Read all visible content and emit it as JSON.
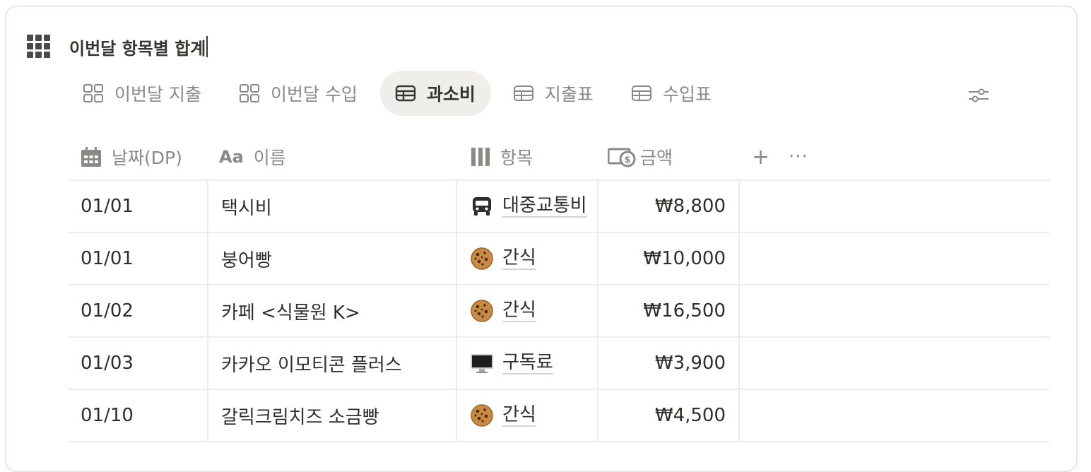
{
  "db": {
    "title": "이번달 항목별 합계"
  },
  "tabs": [
    {
      "label": "이번달 지출",
      "icon": "gallery-icon",
      "active": false
    },
    {
      "label": "이번달 수입",
      "icon": "gallery-icon",
      "active": false
    },
    {
      "label": "과소비",
      "icon": "table-icon",
      "active": true
    },
    {
      "label": "지출표",
      "icon": "table-icon",
      "active": false
    },
    {
      "label": "수입표",
      "icon": "table-icon",
      "active": false
    }
  ],
  "columns": {
    "date": {
      "label": "날짜(DP)",
      "icon": "calendar-icon"
    },
    "name": {
      "label": "이름",
      "icon": "text-aa-icon"
    },
    "category": {
      "label": "항목",
      "icon": "select-bars-icon"
    },
    "amount": {
      "label": "금액",
      "icon": "money-icon"
    },
    "add": "+",
    "more": "···"
  },
  "rows": [
    {
      "date": "01/01",
      "name": "택시비",
      "category": "대중교통비",
      "category_icon": "bus-icon",
      "amount": "₩8,800"
    },
    {
      "date": "01/01",
      "name": "붕어빵",
      "category": "간식",
      "category_icon": "cookie-icon",
      "amount": "₩10,000"
    },
    {
      "date": "01/02",
      "name": "카페 <식물원 K>",
      "category": "간식",
      "category_icon": "cookie-icon",
      "amount": "₩16,500"
    },
    {
      "date": "01/03",
      "name": "카카오 이모티콘 플러스",
      "category": "구독료",
      "category_icon": "computer-icon",
      "amount": "₩3,900"
    },
    {
      "date": "01/10",
      "name": "갈릭크림치즈 소금빵",
      "category": "간식",
      "category_icon": "cookie-icon",
      "amount": "₩4,500"
    }
  ],
  "colors": {
    "active_tab_bg": "#efeeeb",
    "muted_text": "#8a8985",
    "text": "#37352f",
    "border": "#ececea"
  }
}
